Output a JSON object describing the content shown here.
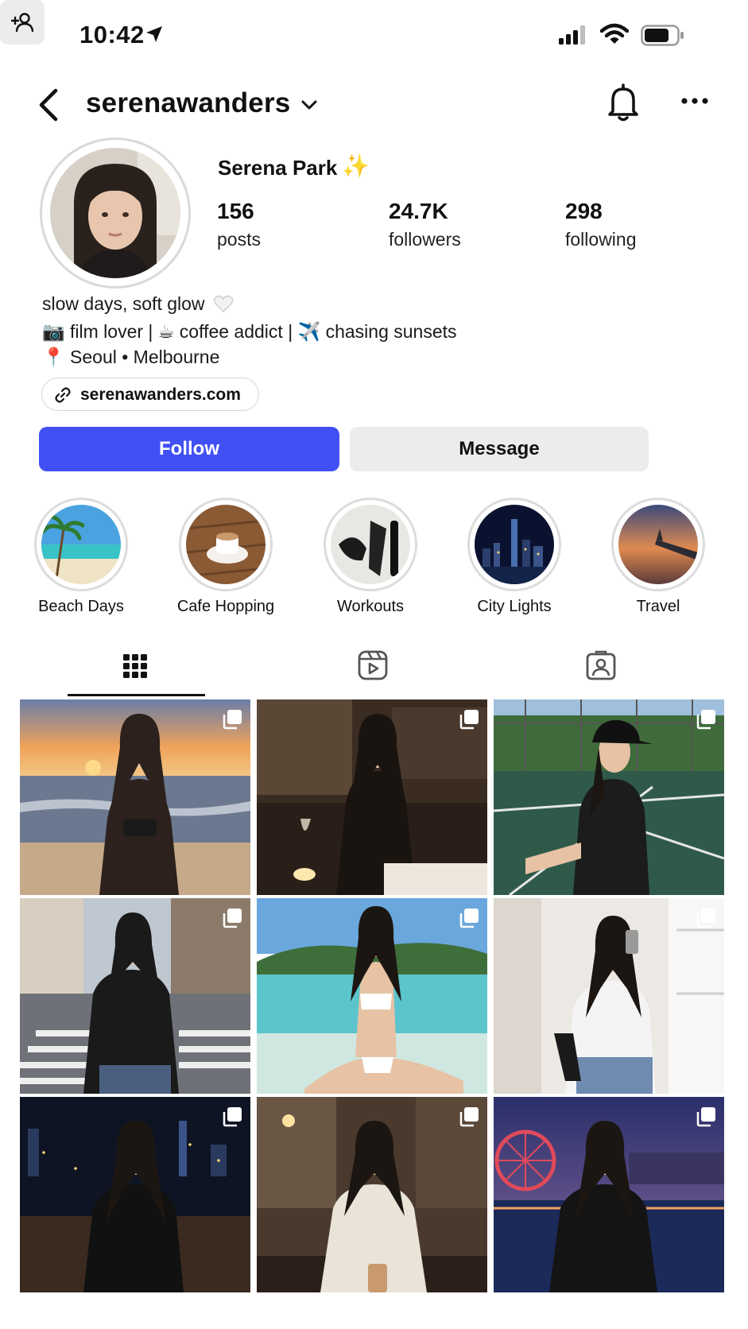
{
  "status_bar": {
    "time": "10:42"
  },
  "header": {
    "username": "serenawanders"
  },
  "profile": {
    "display_name": "Serena Park",
    "sparkle": "✨",
    "stats": {
      "posts": {
        "value": "156",
        "label": "posts"
      },
      "followers": {
        "value": "24.7K",
        "label": "followers"
      },
      "following": {
        "value": "298",
        "label": "following"
      }
    },
    "bio": {
      "line1": "slow days, soft glow",
      "line2": "📷 film lover  |  ☕ coffee addict  |    ✈️ chasing sunsets",
      "line3": "📍 Seoul • Melbourne"
    },
    "link": "serenawanders.com"
  },
  "actions": {
    "follow": "Follow",
    "message": "Message"
  },
  "highlights": [
    {
      "label": "Beach Days"
    },
    {
      "label": "Cafe Hopping"
    },
    {
      "label": "Workouts"
    },
    {
      "label": "City Lights"
    },
    {
      "label": "Travel"
    }
  ],
  "colors": {
    "accent": "#4150f5",
    "secondary_button": "#ececee"
  }
}
